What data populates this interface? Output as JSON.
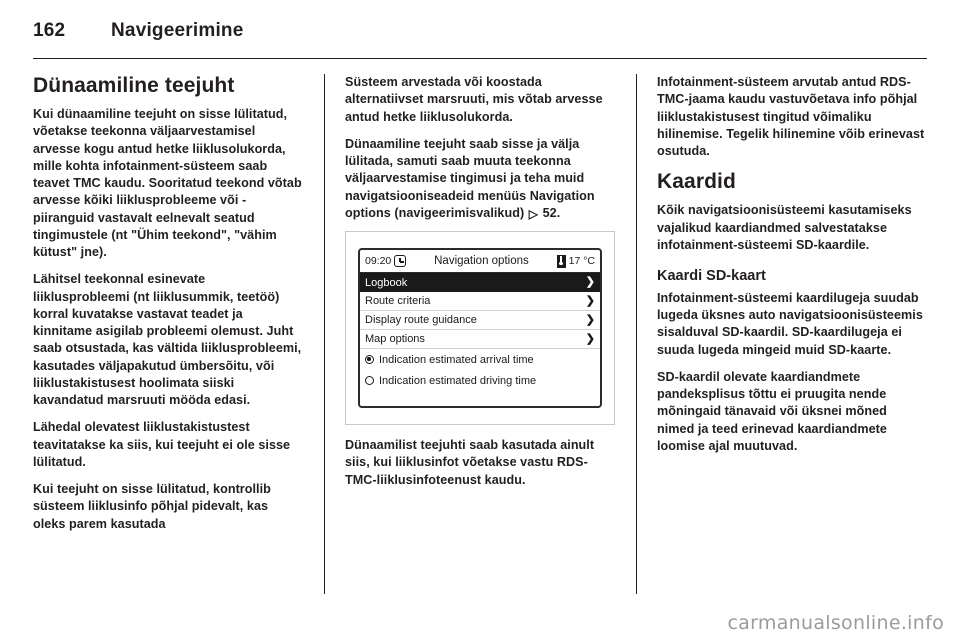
{
  "header": {
    "page_number": "162",
    "chapter_title": "Navigeerimine"
  },
  "left_column": {
    "heading": "Dünaamiline teejuht",
    "paragraphs": [
      "Kui dünaamiline teejuht on sisse lülitatud, võetakse teekonna väljaarvestamisel arvesse kogu antud hetke liiklusolukorda, mille kohta infotainment-süsteem saab teavet TMC kaudu. Sooritatud teekond võtab arvesse kõiki liiklusprobleeme või -piiranguid vastavalt eelnevalt seatud tingimustele (nt \"Ühim teekond\", \"vähim kütust\" jne).",
      "Lähitsel teekonnal esinevate liiklusprobleemi (nt liiklusummik, teetöö) korral kuvatakse vastavat teadet ja kinnitame asigilab probleemi olemust. Juht saab otsustada, kas vältida liiklusprobleemi, kasutades väljapakutud ümbersõitu, või liiklustakistusest hoolimata siiski kavandatud marsruuti mööda edasi.",
      "Lähedal olevatest liiklustakistustest teavitatakse ka siis, kui teejuht ei ole sisse lülitatud.",
      "Kui teejuht on sisse lülitatud, kontrollib süsteem liiklusinfo põhjal pidevalt, kas oleks parem kasutada"
    ]
  },
  "middle_column": {
    "paragraphs_top": [
      "Süsteem arvestada või koostada alternatiivset marsruuti, mis võtab arvesse antud hetke liiklusolukorda.",
      "Dünaamiline teejuht saab sisse ja välja lülitada, samuti saab muuta teekonna väljaarvestamise tingimusi ja teha muid navigatsiooniseadeid menüüs Navigation options (navigeerimisvalikud)"
    ],
    "xref": {
      "arrow": "▷",
      "page": "52"
    },
    "paragraphs_bottom": [
      "Dünaamilist teejuhti saab kasutada ainult siis, kui liiklusinfot võetakse vastu RDS-TMC-liiklusinfoteenust kaudu."
    ],
    "figure": {
      "name": "navigation-options-screen",
      "titlebar": {
        "time": "09:20",
        "clock_icon": "clock-icon",
        "title": "Navigation options",
        "temp_icon": "thermometer-icon",
        "temperature": "17 °C"
      },
      "menu_items": [
        {
          "label": "Logbook",
          "chevron": "❯",
          "selected": true
        },
        {
          "label": "Route criteria",
          "chevron": "❯",
          "selected": false
        },
        {
          "label": "Display route guidance",
          "chevron": "❯",
          "selected": false
        },
        {
          "label": "Map options",
          "chevron": "❯",
          "selected": false
        }
      ],
      "radio_options": [
        {
          "label": "Indication estimated arrival time",
          "selected": true
        },
        {
          "label": "Indication estimated driving time",
          "selected": false
        }
      ]
    }
  },
  "right_column": {
    "paragraphs_top": [
      "Infotainment-süsteem arvutab antud RDS-TMC-jaama kaudu vastuvõetava info põhjal liiklustakistusest tingitud võimaliku hilinemise. Tegelik hilinemine võib erinevast osutuda."
    ],
    "heading": "Kaardid",
    "paragraphs_mid": [
      "Kõik navigatsioonisüsteemi kasutamiseks vajalikud kaardiandmed salvestatakse infotainment-süsteemi SD-kaardile."
    ],
    "subheading": "Kaardi SD-kaart",
    "paragraphs_bottom": [
      "Infotainment-süsteemi kaardilugeja suudab lugeda üksnes auto navigatsioonisüsteemis sisalduval SD-kaardil. SD-kaardilugeja ei suuda lugeda mingeid muid SD-kaarte.",
      "SD-kaardil olevate kaardiandmete pandeksplisus tõttu ei pruugita nende mõningaid tänavaid või üksnei mõned nimed ja teed erinevad kaardiandmete loomise ajal muutuvad."
    ]
  },
  "watermark": "carmanualsonline.info"
}
